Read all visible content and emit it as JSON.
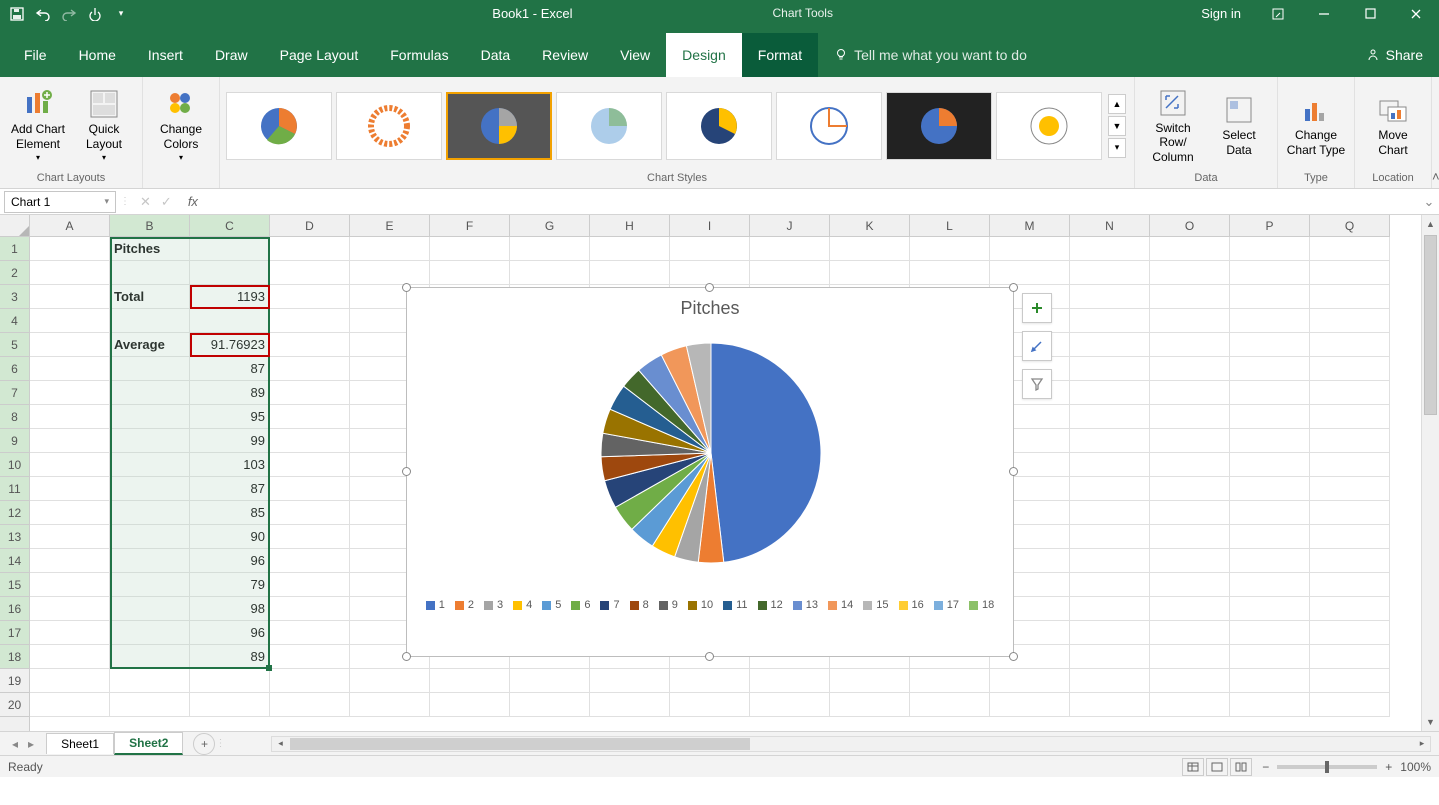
{
  "app": {
    "title": "Book1  -  Excel",
    "context_tool": "Chart Tools",
    "sign_in": "Sign in",
    "share": "Share",
    "tell_me": "Tell me what you want to do"
  },
  "tabs": {
    "file": "File",
    "home": "Home",
    "insert": "Insert",
    "draw": "Draw",
    "page_layout": "Page Layout",
    "formulas": "Formulas",
    "data": "Data",
    "review": "Review",
    "view": "View",
    "design": "Design",
    "format": "Format"
  },
  "ribbon": {
    "chart_layouts": {
      "label": "Chart Layouts",
      "add_element": "Add Chart Element",
      "quick_layout": "Quick Layout"
    },
    "change_colors": "Change Colors",
    "chart_styles_label": "Chart Styles",
    "data_group": {
      "label": "Data",
      "switch": "Switch Row/\nColumn",
      "select": "Select Data"
    },
    "type_group": {
      "label": "Type",
      "change": "Change Chart Type"
    },
    "location_group": {
      "label": "Location",
      "move": "Move Chart"
    }
  },
  "namebox": "Chart 1",
  "columns": [
    "A",
    "B",
    "C",
    "D",
    "E",
    "F",
    "G",
    "H",
    "I",
    "J",
    "K",
    "L",
    "M",
    "N",
    "O",
    "P",
    "Q"
  ],
  "rows_count": 20,
  "cells": {
    "B1": "Pitches",
    "B3": "Total",
    "C3": "1193",
    "B5": "Average",
    "C5": "91.76923",
    "C6": "87",
    "C7": "89",
    "C8": "95",
    "C9": "99",
    "C10": "103",
    "C11": "87",
    "C12": "85",
    "C13": "90",
    "C14": "96",
    "C15": "79",
    "C16": "98",
    "C17": "96",
    "C18": "89"
  },
  "sheets": {
    "s1": "Sheet1",
    "s2": "Sheet2"
  },
  "status": {
    "ready": "Ready",
    "zoom": "100%"
  },
  "chart_data": {
    "type": "pie",
    "title": "Pitches",
    "categories": [
      "1",
      "2",
      "3",
      "4",
      "5",
      "6",
      "7",
      "8",
      "9",
      "10",
      "11",
      "12",
      "13",
      "14",
      "15",
      "16",
      "17",
      "18"
    ],
    "values": [
      1193,
      91.76923,
      87,
      89,
      95,
      99,
      103,
      87,
      85,
      90,
      96,
      79,
      98,
      96,
      89,
      0,
      0,
      0
    ],
    "colors": [
      "#4472C4",
      "#ED7D31",
      "#A5A5A5",
      "#FFC000",
      "#5B9BD5",
      "#70AD47",
      "#264478",
      "#9E480E",
      "#636363",
      "#997300",
      "#255E91",
      "#43682B",
      "#698ED0",
      "#F1975A",
      "#B7B7B7",
      "#FFCD33",
      "#7CAFDD",
      "#8CC168"
    ]
  }
}
